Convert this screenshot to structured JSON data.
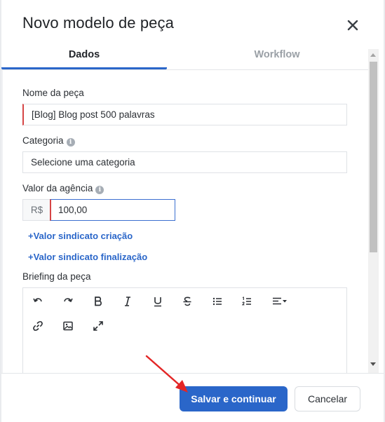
{
  "dialog": {
    "title": "Novo modelo de peça"
  },
  "tabs": [
    {
      "label": "Dados",
      "active": true
    },
    {
      "label": "Workflow",
      "active": false
    }
  ],
  "form": {
    "name_label": "Nome da peça",
    "name_value": "[Blog] Blog post 500 palavras",
    "category_label": "Categoria",
    "category_placeholder": "Selecione uma categoria",
    "agency_value_label": "Valor da agência",
    "currency_prefix": "R$",
    "agency_value": "100,00",
    "link_creation": "+Valor sindicato criação",
    "link_finalization": "+Valor sindicato finalização",
    "briefing_label": "Briefing da peça"
  },
  "editor_toolbar": [
    "undo-icon",
    "redo-icon",
    "bold-icon",
    "italic-icon",
    "underline-icon",
    "strikethrough-icon",
    "bullet-list-icon",
    "numbered-list-icon",
    "align-dropdown-icon",
    "link-icon",
    "image-icon",
    "fullscreen-icon"
  ],
  "footer": {
    "save_label": "Salvar e continuar",
    "cancel_label": "Cancelar"
  },
  "colors": {
    "primary": "#2a66c9",
    "error_border": "#d64545",
    "annotation_arrow": "#e32626"
  }
}
